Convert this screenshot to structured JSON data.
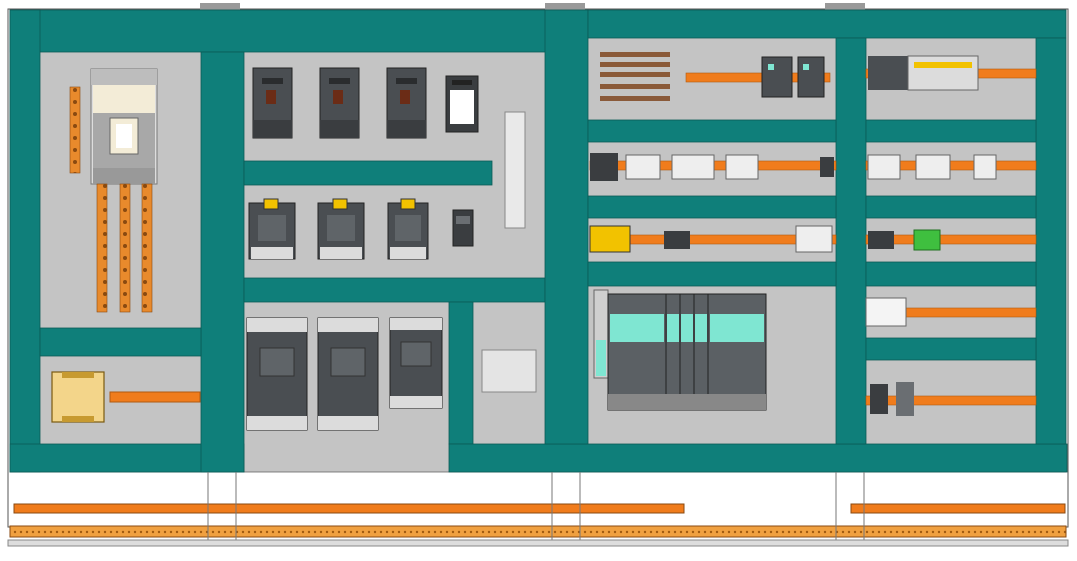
{
  "colors": {
    "duct": "#0f7f7a",
    "panel": "#c4c4c4",
    "rail": "#f07c1c",
    "busbar": "#e88a2c",
    "breaker_dark": "#4a4e52",
    "breaker_mid": "#5b6064",
    "accent_yellow": "#f2c200",
    "plc_teal": "#7fe6d2",
    "frame": "#8a8a8a"
  },
  "icons": [
    "contactor-icon",
    "breaker-icon",
    "terminal-block-icon",
    "plc-module-icon",
    "power-supply-icon",
    "busbar-icon"
  ]
}
